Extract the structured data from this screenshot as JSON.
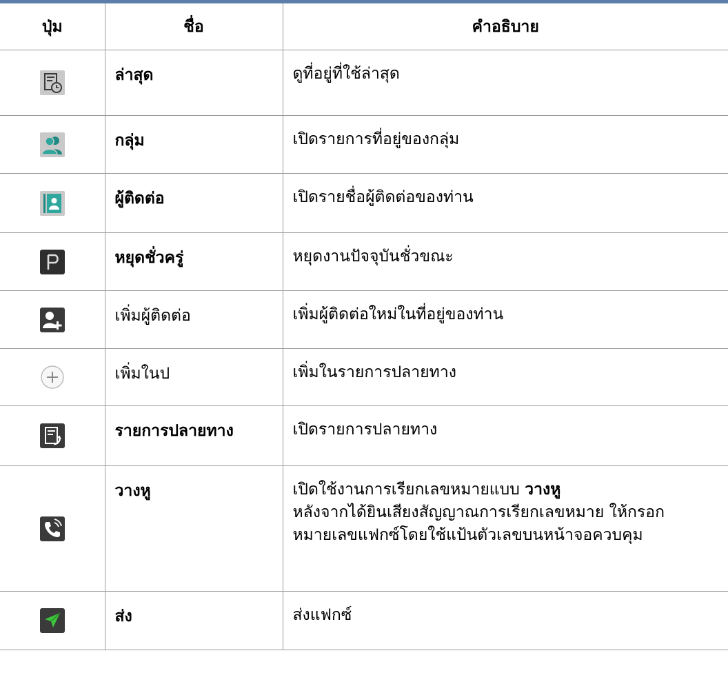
{
  "header": {
    "col_button": "ปุ่ม",
    "col_name": "ชื่อ",
    "col_desc": "คำอธิบาย"
  },
  "rows": [
    {
      "icon": "recent-icon",
      "name": "ล่าสุด",
      "name_bold": true,
      "desc": "ดูที่อยู่ที่ใช้ล่าสุด"
    },
    {
      "icon": "group-icon",
      "name": "กลุ่ม",
      "name_bold": true,
      "desc": "เปิดรายการที่อยู่ของกลุ่ม"
    },
    {
      "icon": "contact-book-icon",
      "name": "ผู้ติดต่อ",
      "name_bold": true,
      "desc": "เปิดรายชื่อผู้ติดต่อของท่าน"
    },
    {
      "icon": "pause-p-icon",
      "name": "หยุดชั่วครู่",
      "name_bold": true,
      "desc": "หยุดงานปัจจุบันชั่วขณะ"
    },
    {
      "icon": "add-contact-icon",
      "name": "เพิ่มผู้ติดต่อ",
      "name_bold": false,
      "desc": "เพิ่มผู้ติดต่อใหม่ในที่อยู่ของท่าน"
    },
    {
      "icon": "plus-circle-icon",
      "name": "เพิ่มในป",
      "name_bold": false,
      "desc": "เพิ่มในรายการปลายทาง"
    },
    {
      "icon": "destination-list-icon",
      "name": "รายการปลายทาง",
      "name_bold": true,
      "desc": "เปิดรายการปลายทาง"
    },
    {
      "icon": "on-hook-icon",
      "name": "วางหู",
      "name_bold": true,
      "desc_prefix": "เปิดใช้งานการเรียกเลขหมายแบบ ",
      "desc_bold": "วางหู",
      "desc_rest": "หลังจากได้ยินเสียงสัญญาณการเรียกเลขหมาย ให้กรอกหมายเลขแฟกซ์โดยใช้แป้นตัวเลขบนหน้าจอควบคุม"
    },
    {
      "icon": "send-icon",
      "name": "ส่ง",
      "name_bold": true,
      "desc": "ส่งแฟกซ์"
    }
  ],
  "colors": {
    "top_bar": "#5b7fa8",
    "rule": "#9a9a9a",
    "send_green": "#3cc43a"
  }
}
